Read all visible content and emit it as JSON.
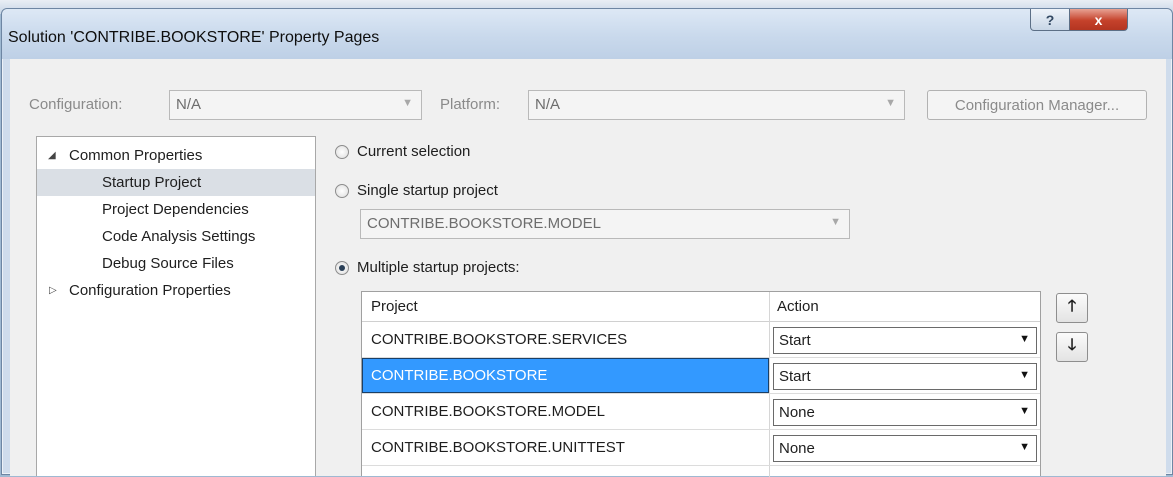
{
  "window": {
    "title": "Solution 'CONTRIBE.BOOKSTORE' Property Pages",
    "help_label": "?",
    "close_label": "x"
  },
  "config": {
    "configuration_label": "Configuration:",
    "configuration_value": "N/A",
    "platform_label": "Platform:",
    "platform_value": "N/A",
    "manager_button": "Configuration Manager...",
    "arrow": "▼"
  },
  "tree": {
    "common": {
      "arrow": "◢",
      "label": "Common Properties"
    },
    "items": [
      "Startup Project",
      "Project Dependencies",
      "Code Analysis Settings",
      "Debug Source Files"
    ],
    "config_props": {
      "arrow": "▷",
      "label": "Configuration Properties"
    }
  },
  "startup": {
    "current_selection": "Current selection",
    "single_startup": "Single startup project",
    "single_value": "CONTRIBE.BOOKSTORE.MODEL",
    "multiple_startup": "Multiple startup projects:",
    "selected_option": "multiple"
  },
  "grid": {
    "col_project": "Project",
    "col_action": "Action",
    "rows": [
      {
        "project": "CONTRIBE.BOOKSTORE.SERVICES",
        "action": "Start"
      },
      {
        "project": "CONTRIBE.BOOKSTORE",
        "action": "Start"
      },
      {
        "project": "CONTRIBE.BOOKSTORE.MODEL",
        "action": "None"
      },
      {
        "project": "CONTRIBE.BOOKSTORE.UNITTEST",
        "action": "None"
      }
    ],
    "selected_row": 1,
    "move_up": "🡑",
    "move_down": "🡓",
    "dropdown_arrow": "▼"
  }
}
